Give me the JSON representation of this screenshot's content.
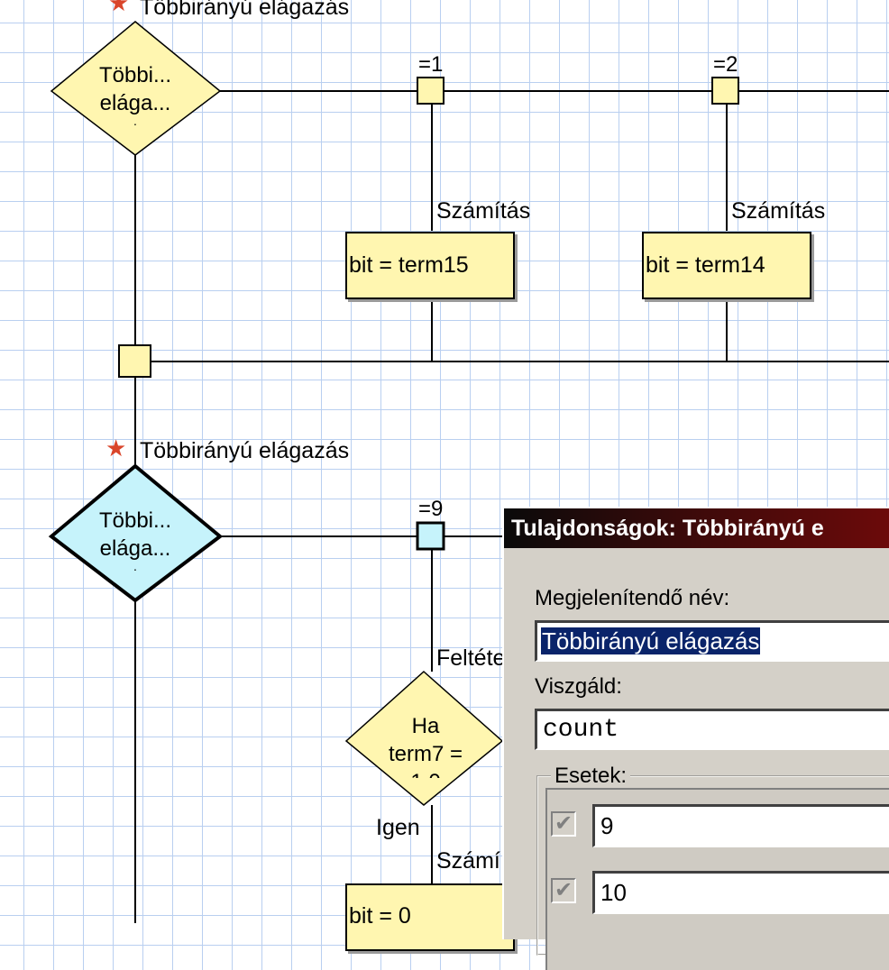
{
  "diagram": {
    "top_title": "Többirányú elágazás",
    "top_decision": {
      "line1": "Többi...",
      "line2": "elága...",
      "line3": "."
    },
    "case_1": "=1",
    "case_2": "=2",
    "calc_label_1": "Számítás",
    "calc_label_2": "Számítás",
    "calc_box_1": "bit = term15",
    "calc_box_2": "bit = term14",
    "second_title": "Többirányú elágazás",
    "second_decision": {
      "line1": "Többi...",
      "line2": "elága...",
      "line3": "."
    },
    "case_9": "=9",
    "condition_label": "Feltéte",
    "if_decision": {
      "line1": "Ha",
      "line2": "term7 =",
      "line3": "1 0"
    },
    "yes_label": "Igen",
    "calc_label_3": "Számí",
    "calc_box_3": "bit = 0",
    "colors": {
      "box": "#fff6b0",
      "selected": "#c6f3fb",
      "grid": "#b9cff0"
    }
  },
  "dialog": {
    "title": "Tulajdonságok: Többirányú e",
    "display_name_label": "Megjelenítendő név:",
    "display_name_value": "Többirányú elágazás",
    "examine_label": "Viszgáld:",
    "examine_value": "count",
    "cases_label": "Esetek:",
    "cases": [
      {
        "checked": true,
        "value": "9"
      },
      {
        "checked": true,
        "value": "10"
      }
    ]
  }
}
